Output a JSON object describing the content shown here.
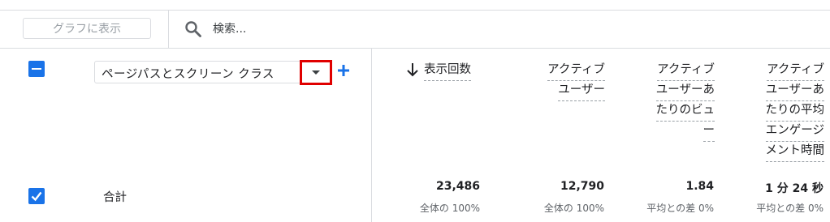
{
  "toolbar": {
    "graph_button_label": "グラフに表示",
    "search_placeholder": "検索..."
  },
  "dimension": {
    "label": "ページパスとスクリーン クラス",
    "add_icon": "plus-icon",
    "dropdown_icon": "caret-down-icon"
  },
  "sort_icon": "arrow-down-icon",
  "metrics": [
    {
      "label": "表示回数",
      "label_lines": [
        "表示回数"
      ],
      "value": "23,486",
      "sub": "全体の 100%"
    },
    {
      "label": "アクティブユーザー",
      "label_lines": [
        "アクティブ",
        "ユーザー"
      ],
      "value": "12,790",
      "sub": "全体の 100%"
    },
    {
      "label": "アクティブユーザーあたりのビュー",
      "label_lines": [
        "アクティブ",
        "ユーザーあ",
        "たりのビュ",
        "ー"
      ],
      "value": "1.84",
      "sub": "平均との差 0%"
    },
    {
      "label": "アクティブユーザーあたりの平均エンゲージメント時間",
      "label_lines": [
        "アクティブ",
        "ユーザーあ",
        "たりの平均",
        "エンゲージ",
        "メント時間"
      ],
      "value": "1 分 24 秒",
      "sub": "平均との差 0%"
    }
  ],
  "totals_row": {
    "label": "合計",
    "checked": true
  },
  "header_checkbox": {
    "state": "indeterminate"
  },
  "colors": {
    "accent": "#1a73e8",
    "highlight": "#e00000",
    "divider": "#dadce0"
  }
}
